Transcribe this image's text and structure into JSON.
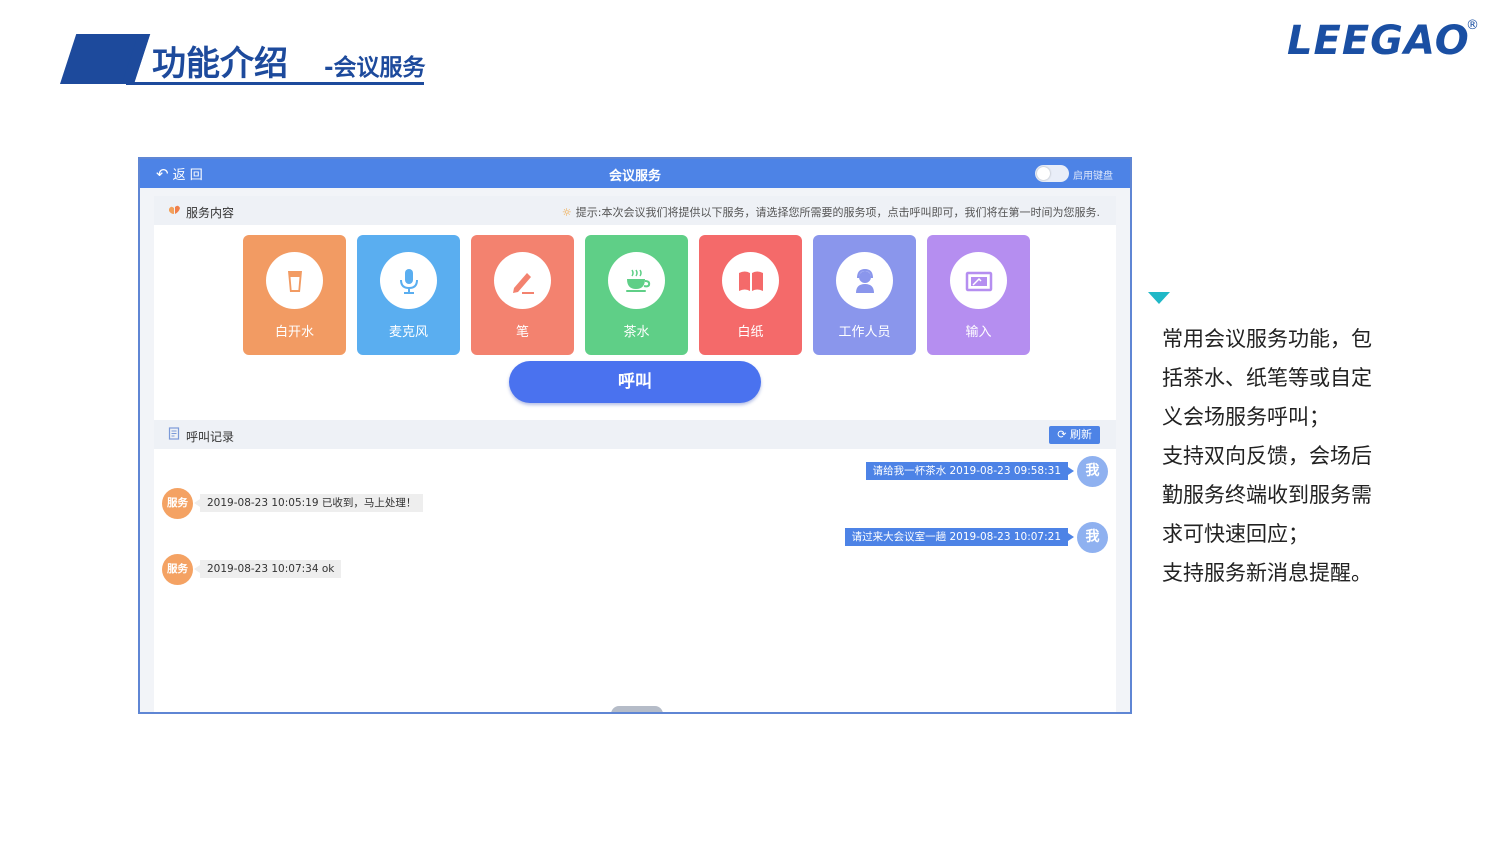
{
  "slide": {
    "title": "功能介绍",
    "subtitle": "-会议服务",
    "logo": "LEEGAO",
    "logo_mark": "®"
  },
  "app": {
    "back_label": "返 回",
    "title": "会议服务",
    "keyboard_toggle_label": "启用键盘",
    "service_section": {
      "label": "服务内容",
      "hint": "提示:本次会议我们将提供以下服务，请选择您所需要的服务项，点击呼叫即可，我们将在第一时间为您服务."
    },
    "services": [
      {
        "label": "白开水",
        "icon": "water-glass-icon",
        "color": "#f29b63"
      },
      {
        "label": "麦克风",
        "icon": "microphone-icon",
        "color": "#5aaef0"
      },
      {
        "label": "笔",
        "icon": "pen-icon",
        "color": "#f3826f"
      },
      {
        "label": "茶水",
        "icon": "tea-cup-icon",
        "color": "#5fcf87"
      },
      {
        "label": "白纸",
        "icon": "book-icon",
        "color": "#f46a6a"
      },
      {
        "label": "工作人员",
        "icon": "staff-icon",
        "color": "#8a96ec"
      },
      {
        "label": "输入",
        "icon": "input-icon",
        "color": "#b58ef0"
      }
    ],
    "call_label": "呼叫",
    "log_section": {
      "label": "呼叫记录",
      "refresh_label": "刷新"
    },
    "messages": [
      {
        "side": "right",
        "text": "请给我一杯茶水 2019-08-23 09:58:31",
        "avatar": "我"
      },
      {
        "side": "left",
        "text": "2019-08-23 10:05:19 已收到，马上处理！",
        "avatar": "服务"
      },
      {
        "side": "right",
        "text": "请过来大会议室一趟 2019-08-23 10:07:21",
        "avatar": "我"
      },
      {
        "side": "left",
        "text": "2019-08-23 10:07:34 ok",
        "avatar": "服务"
      }
    ]
  },
  "side_description": [
    "常用会议服务功能，包",
    "括茶水、纸笔等或自定",
    "义会场服务呼叫；",
    "支持双向反馈，会场后",
    "勤服务终端收到服务需",
    "求可快速回应；",
    "支持服务新消息提醒。"
  ]
}
